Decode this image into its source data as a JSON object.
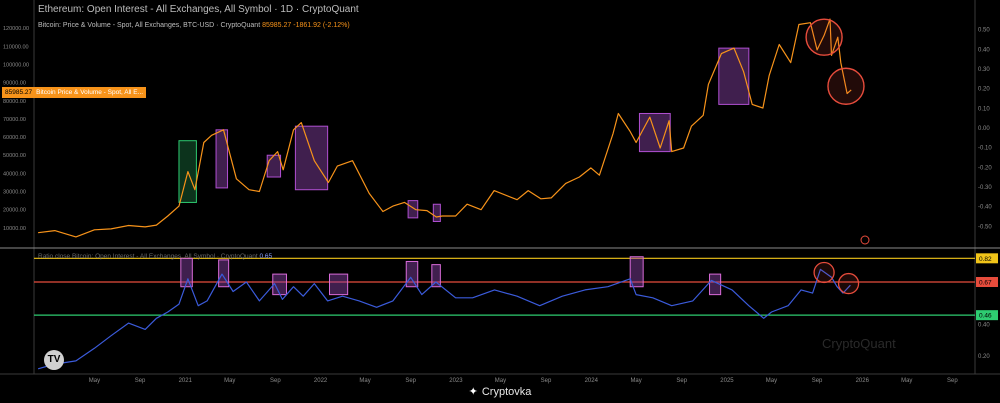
{
  "header": {
    "title": "Ethereum: Open Interest - All Exchanges, All Symbol · 1D · CryptoQuant",
    "subtitle": "Bitcoin: Price & Volume - Spot, All Exchanges, BTC-USD · CryptoQuant",
    "subtitle_price": "85985.27",
    "subtitle_change": "-1861.92 (-2.12%)"
  },
  "price_tag": {
    "value": "85985.27",
    "label": "Bitcoin Price & Volume - Spot, All E..."
  },
  "ratio_label": {
    "text": "Ratio close Bitcoin: Open Interest - All Exchanges, All Symbol · CryptoQuant",
    "value": "0.65"
  },
  "watermark": "CryptoQuant",
  "brand": "Cryptovka",
  "colors": {
    "price": "#f7931a",
    "ratio": "#3b5bdb",
    "box": "#8e44ad",
    "green_box": "#2ecc71",
    "circle": "#e74c3c"
  },
  "chart_data": [
    {
      "type": "line",
      "series": [
        {
          "name": "Bitcoin Price & Volume - Spot, All E...",
          "x": [
            "2019-12-01",
            "2020-01-15",
            "2020-03-12",
            "2020-05-01",
            "2020-06-15",
            "2020-08-01",
            "2020-09-15",
            "2020-10-15",
            "2020-11-15",
            "2020-12-15",
            "2021-01-08",
            "2021-01-27",
            "2021-02-20",
            "2021-03-13",
            "2021-04-14",
            "2021-05-19",
            "2021-06-22",
            "2021-07-20",
            "2021-08-15",
            "2021-09-07",
            "2021-09-22",
            "2021-10-20",
            "2021-11-10",
            "2021-12-15",
            "2022-01-22",
            "2022-02-15",
            "2022-03-28",
            "2022-05-12",
            "2022-06-18",
            "2022-07-15",
            "2022-08-15",
            "2022-09-15",
            "2022-10-15",
            "2022-11-09",
            "2022-11-25",
            "2022-12-31",
            "2023-01-31",
            "2023-03-10",
            "2023-04-14",
            "2023-06-15",
            "2023-07-15",
            "2023-08-18",
            "2023-09-15",
            "2023-10-24",
            "2023-11-30",
            "2023-12-31",
            "2024-01-23",
            "2024-02-29",
            "2024-03-14",
            "2024-04-15",
            "2024-05-01",
            "2024-06-07",
            "2024-07-05",
            "2024-07-29",
            "2024-08-05",
            "2024-09-06",
            "2024-09-27",
            "2024-10-29",
            "2024-11-12",
            "2024-12-17",
            "2025-01-20",
            "2025-02-15",
            "2025-03-10",
            "2025-04-08",
            "2025-04-25",
            "2025-05-22",
            "2025-06-22",
            "2025-07-14",
            "2025-08-14",
            "2025-09-01",
            "2025-09-20",
            "2025-10-06",
            "2025-10-10",
            "2025-10-27",
            "2025-11-04",
            "2025-11-21",
            "2025-12-02"
          ],
          "values": [
            7300,
            8500,
            5000,
            8900,
            9400,
            11300,
            10500,
            11500,
            16500,
            22000,
            41000,
            31000,
            57000,
            61000,
            64000,
            37000,
            31000,
            30000,
            47000,
            52000,
            42000,
            64000,
            68000,
            47000,
            35000,
            44000,
            47000,
            29000,
            19000,
            22000,
            24000,
            20000,
            19500,
            16000,
            16500,
            16500,
            23000,
            20000,
            30500,
            25500,
            30500,
            26000,
            26500,
            34500,
            38000,
            43000,
            39000,
            62000,
            73000,
            63000,
            57000,
            71000,
            54000,
            69000,
            52000,
            54000,
            66000,
            72000,
            89000,
            106000,
            109000,
            96000,
            78000,
            76000,
            94000,
            111000,
            101000,
            122000,
            123000,
            108000,
            116000,
            125000,
            105000,
            115000,
            101000,
            84000,
            86000
          ]
        }
      ],
      "ylim": [
        0,
        130000
      ],
      "yticks": [
        "10000.00",
        "20000.00",
        "30000.00",
        "40000.00",
        "50000.00",
        "60000.00",
        "70000.00",
        "80000.00",
        "90000.00",
        "100000.00",
        "110000.00",
        "120000.00"
      ],
      "right_ylim": [
        -0.6,
        0.6
      ],
      "right_yticks": [
        "0.50",
        "0.40",
        "0.30",
        "0.20",
        "0.10",
        "0.00",
        "-0.10",
        "-0.20",
        "-0.30",
        "-0.40",
        "-0.50"
      ],
      "boxes": [
        {
          "x0": "2020-12-15",
          "x1": "2021-01-31",
          "y0": 24000,
          "y1": 58000,
          "color": "green"
        },
        {
          "x0": "2021-03-25",
          "x1": "2021-04-25",
          "y0": 32000,
          "y1": 64000,
          "color": "purple"
        },
        {
          "x0": "2021-08-10",
          "x1": "2021-09-15",
          "y0": 38000,
          "y1": 50000,
          "color": "purple"
        },
        {
          "x0": "2021-10-25",
          "x1": "2022-01-20",
          "y0": 31000,
          "y1": 66000,
          "color": "purple"
        },
        {
          "x0": "2022-08-25",
          "x1": "2022-09-20",
          "y0": 15500,
          "y1": 25000,
          "color": "purple"
        },
        {
          "x0": "2022-11-01",
          "x1": "2022-11-20",
          "y0": 13500,
          "y1": 23000,
          "color": "purple"
        },
        {
          "x0": "2024-05-10",
          "x1": "2024-08-01",
          "y0": 52000,
          "y1": 73000,
          "color": "purple"
        },
        {
          "x0": "2024-12-10",
          "x1": "2025-03-01",
          "y0": 78000,
          "y1": 109000,
          "color": "purple"
        }
      ],
      "circles": [
        {
          "x": "2025-09-20",
          "y": 115000
        },
        {
          "x": "2025-11-18",
          "y": 88000
        }
      ]
    },
    {
      "type": "line",
      "series": [
        {
          "name": "Ratio close Bitcoin: Open Interest - All Exchanges, All Symbol",
          "x": [
            "2019-12-01",
            "2020-01-15",
            "2020-03-12",
            "2020-05-01",
            "2020-06-15",
            "2020-08-01",
            "2020-09-15",
            "2020-10-15",
            "2020-11-15",
            "2020-12-15",
            "2021-01-08",
            "2021-02-05",
            "2021-03-01",
            "2021-04-10",
            "2021-05-10",
            "2021-06-15",
            "2021-07-20",
            "2021-08-30",
            "2021-09-20",
            "2021-10-20",
            "2021-11-15",
            "2021-12-15",
            "2022-01-20",
            "2022-03-01",
            "2022-04-15",
            "2022-06-01",
            "2022-07-15",
            "2022-09-01",
            "2022-10-01",
            "2022-11-08",
            "2022-12-31",
            "2023-02-15",
            "2023-04-15",
            "2023-06-15",
            "2023-08-15",
            "2023-10-15",
            "2023-12-15",
            "2024-02-15",
            "2024-04-15",
            "2024-05-01",
            "2024-06-15",
            "2024-08-05",
            "2024-10-01",
            "2024-11-20",
            "2025-01-15",
            "2025-03-01",
            "2025-04-10",
            "2025-05-01",
            "2025-06-15",
            "2025-07-20",
            "2025-08-20",
            "2025-09-10",
            "2025-10-10",
            "2025-10-25",
            "2025-11-10",
            "2025-11-30"
          ],
          "values": [
            0.12,
            0.15,
            0.17,
            0.25,
            0.33,
            0.41,
            0.37,
            0.44,
            0.48,
            0.53,
            0.69,
            0.52,
            0.55,
            0.72,
            0.61,
            0.67,
            0.55,
            0.66,
            0.56,
            0.64,
            0.58,
            0.66,
            0.55,
            0.58,
            0.55,
            0.51,
            0.55,
            0.7,
            0.59,
            0.67,
            0.57,
            0.57,
            0.62,
            0.58,
            0.52,
            0.58,
            0.62,
            0.64,
            0.69,
            0.59,
            0.57,
            0.52,
            0.55,
            0.68,
            0.62,
            0.52,
            0.44,
            0.48,
            0.52,
            0.62,
            0.6,
            0.75,
            0.7,
            0.64,
            0.6,
            0.65
          ]
        }
      ],
      "ylim": [
        0.1,
        0.86
      ],
      "yticks": [
        "0.40",
        "0.20"
      ],
      "levels": [
        {
          "value": 0.82,
          "label": "0.82",
          "color": "#f0c419"
        },
        {
          "value": 0.67,
          "label": "0.67",
          "color": "#e74c3c"
        },
        {
          "value": 0.46,
          "label": "0.46",
          "color": "#2ecc71"
        }
      ],
      "boxes": [
        {
          "x0": "2020-12-20",
          "x1": "2021-01-20",
          "y0": 0.64,
          "y1": 0.82
        },
        {
          "x0": "2021-04-01",
          "x1": "2021-04-28",
          "y0": 0.64,
          "y1": 0.81
        },
        {
          "x0": "2021-08-25",
          "x1": "2021-10-01",
          "y0": 0.59,
          "y1": 0.72
        },
        {
          "x0": "2022-01-25",
          "x1": "2022-03-15",
          "y0": 0.59,
          "y1": 0.72
        },
        {
          "x0": "2022-08-20",
          "x1": "2022-09-20",
          "y0": 0.64,
          "y1": 0.8
        },
        {
          "x0": "2022-10-28",
          "x1": "2022-11-20",
          "y0": 0.64,
          "y1": 0.78
        },
        {
          "x0": "2024-04-15",
          "x1": "2024-05-20",
          "y0": 0.64,
          "y1": 0.83
        },
        {
          "x0": "2024-11-15",
          "x1": "2024-12-15",
          "y0": 0.59,
          "y1": 0.72
        }
      ],
      "circles": [
        {
          "x": "2025-09-20",
          "y": 0.73
        },
        {
          "x": "2025-11-25",
          "y": 0.66
        }
      ]
    }
  ],
  "x_axis": {
    "ticks": [
      {
        "date": "2020-05-01",
        "label": "May"
      },
      {
        "date": "2020-09-01",
        "label": "Sep"
      },
      {
        "date": "2021-01-01",
        "label": "2021"
      },
      {
        "date": "2021-05-01",
        "label": "May"
      },
      {
        "date": "2021-09-01",
        "label": "Sep"
      },
      {
        "date": "2022-01-01",
        "label": "2022"
      },
      {
        "date": "2022-05-01",
        "label": "May"
      },
      {
        "date": "2022-09-01",
        "label": "Sep"
      },
      {
        "date": "2023-01-01",
        "label": "2023"
      },
      {
        "date": "2023-05-01",
        "label": "May"
      },
      {
        "date": "2023-09-01",
        "label": "Sep"
      },
      {
        "date": "2024-01-01",
        "label": "2024"
      },
      {
        "date": "2024-05-01",
        "label": "May"
      },
      {
        "date": "2024-09-01",
        "label": "Sep"
      },
      {
        "date": "2025-01-01",
        "label": "2025"
      },
      {
        "date": "2025-05-01",
        "label": "May"
      },
      {
        "date": "2025-09-01",
        "label": "Sep"
      },
      {
        "date": "2026-01-01",
        "label": "2026"
      },
      {
        "date": "2026-05-01",
        "label": "May"
      },
      {
        "date": "2026-09-01",
        "label": "Sep"
      }
    ]
  }
}
